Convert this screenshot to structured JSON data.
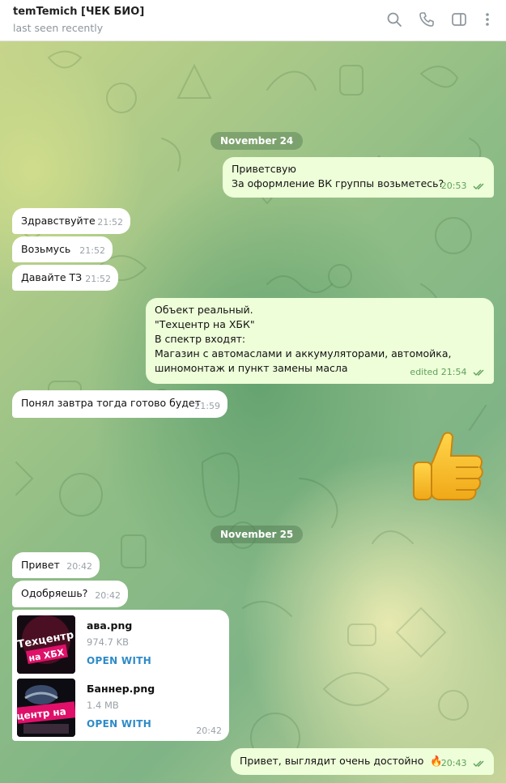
{
  "header": {
    "title": "temTemich [ЧЕК БИО]",
    "status": "last seen recently"
  },
  "dates": {
    "first": "November 24",
    "second": "November 25"
  },
  "messages": {
    "m1": {
      "lines": [
        "Приветсвую",
        "За оформление ВК группы возьметесь?"
      ],
      "time": "20:53"
    },
    "m2": {
      "text": "Здравствуйте",
      "time": "21:52"
    },
    "m3": {
      "text": "Возьмусь",
      "time": "21:52"
    },
    "m4": {
      "text": "Давайте ТЗ",
      "time": "21:52"
    },
    "m5": {
      "lines": [
        "Объект реальный.",
        "\"Техцентр на ХБК\"",
        "В спектр входят:",
        "Магазин с автомаслами и аккумуляторами, автомойка,",
        "шиномонтаж и пункт замены масла"
      ],
      "time": "edited 21:54"
    },
    "m6": {
      "text": "Понял завтра тогда готово будет",
      "time": "21:59"
    },
    "m7": {
      "text": "Привет",
      "time": "20:42"
    },
    "m8": {
      "text": "Одобряешь?",
      "time": "20:42"
    },
    "files": {
      "time": "20:42",
      "items": [
        {
          "name": "ава.png",
          "size": "974.7 KB",
          "action": "OPEN WITH",
          "thumb_text": "Техцентр на ХБК"
        },
        {
          "name": "Баннер.png",
          "size": "1.4 MB",
          "action": "OPEN WITH",
          "thumb_text": "центр на"
        }
      ]
    },
    "m9": {
      "text": "Привет, выглядит очень достойно",
      "emoji": "🔥",
      "time": "20:43"
    }
  },
  "colors": {
    "incoming_bubble": "#ffffff",
    "outgoing_bubble": "#eefed9",
    "link": "#2f8bc8",
    "read_checks": "#5fa15a"
  },
  "icons": [
    "search-icon",
    "phone-icon",
    "sidebar-toggle-icon",
    "more-vertical-icon",
    "double-check-icon",
    "thumbs-up-sticker",
    "fire-emoji"
  ]
}
